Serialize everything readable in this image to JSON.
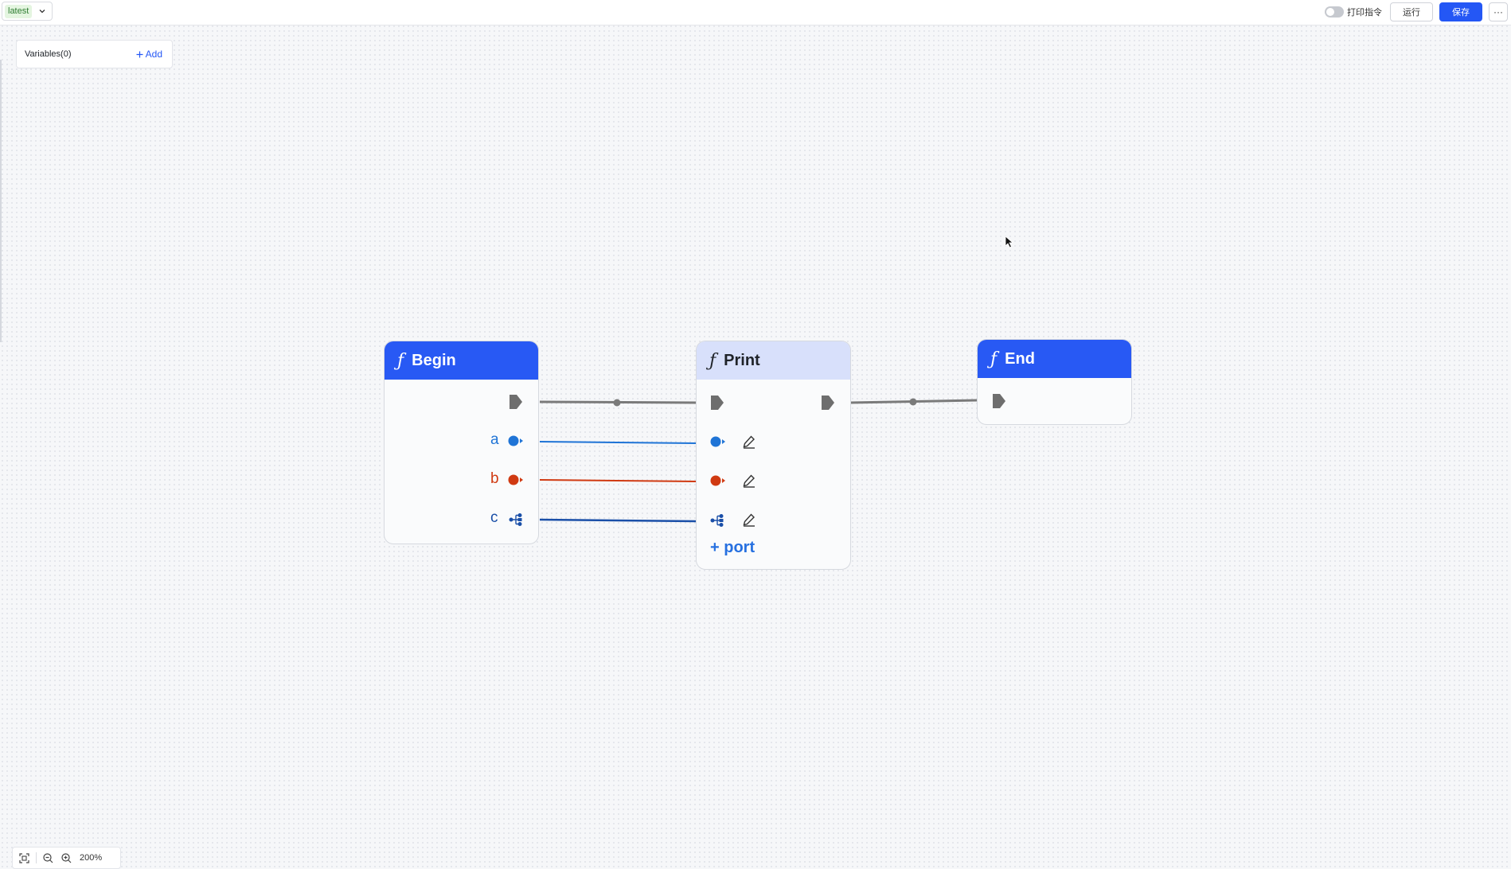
{
  "toolbar": {
    "version_tag": "latest",
    "print_toggle_label": "打印指令",
    "run_label": "运行",
    "save_label": "保存",
    "more_label": "···"
  },
  "variables_panel": {
    "title": "Variables(0)",
    "add_label": "Add"
  },
  "nodes": {
    "begin": {
      "icon": "ƒ",
      "title": "Begin",
      "ports": [
        "a",
        "b",
        "c"
      ]
    },
    "print": {
      "icon": "ƒ",
      "title": "Print",
      "add_port_label": "+ port"
    },
    "end": {
      "icon": "ƒ",
      "title": "End"
    }
  },
  "zoom": {
    "level": "200%"
  },
  "colors": {
    "primary": "#2457f5",
    "node_header": "#2859f4",
    "node_header_selected": "#d8e0fb",
    "port_a": "#1f74d6",
    "port_b": "#d03a12",
    "port_c": "#1a4fa8",
    "flow_line": "#7a7a7a"
  }
}
